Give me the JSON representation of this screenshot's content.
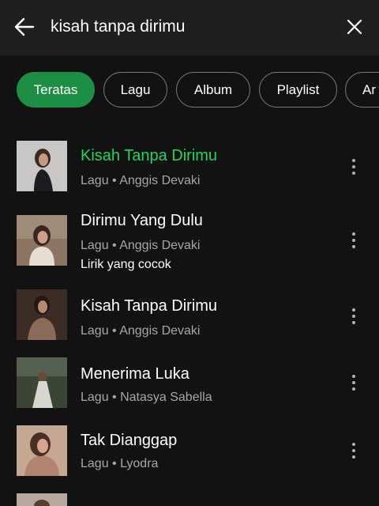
{
  "search": {
    "query": "kisah tanpa dirimu",
    "back_icon": "back-arrow-icon",
    "clear_icon": "close-icon"
  },
  "filters": [
    {
      "label": "Teratas",
      "active": true
    },
    {
      "label": "Lagu",
      "active": false
    },
    {
      "label": "Album",
      "active": false
    },
    {
      "label": "Playlist",
      "active": false
    },
    {
      "label": "Ar",
      "active": false
    }
  ],
  "colors": {
    "accent_green": "#1ed760",
    "chip_active": "#1c8f45",
    "background": "#121212",
    "secondary_text": "#a7a7a7"
  },
  "results": [
    {
      "title": "Kisah Tanpa Dirimu",
      "meta": "Lagu • Anggis Devaki",
      "lyric": "",
      "playing": true
    },
    {
      "title": "Dirimu Yang Dulu",
      "meta": "Lagu • Anggis Devaki",
      "lyric": "Lirik yang cocok",
      "playing": false
    },
    {
      "title": "Kisah Tanpa Dirimu",
      "meta": "Lagu • Anggis Devaki",
      "lyric": "",
      "playing": false
    },
    {
      "title": "Menerima Luka",
      "meta": "Lagu • Natasya Sabella",
      "lyric": "",
      "playing": false
    },
    {
      "title": "Tak Dianggap",
      "meta": "Lagu • Lyodra",
      "lyric": "",
      "playing": false
    }
  ]
}
